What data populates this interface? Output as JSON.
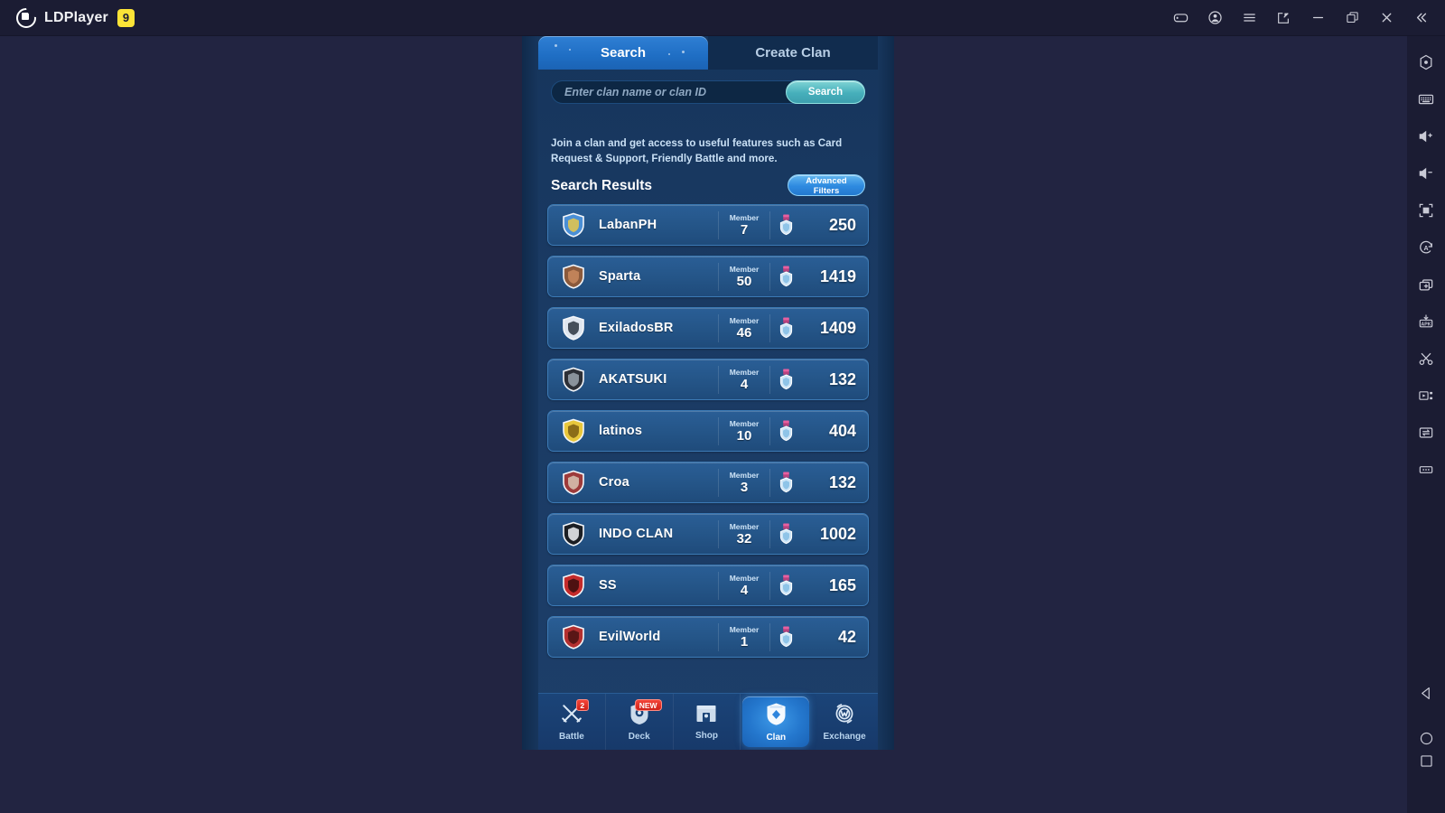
{
  "emulator": {
    "brand_name": "LDPlayer",
    "brand_version": "9",
    "titlebar_buttons": [
      {
        "name": "gamepad-icon",
        "label": "Keyboard Mapping"
      },
      {
        "name": "account-icon",
        "label": "Account"
      },
      {
        "name": "menu-icon",
        "label": "Menu"
      },
      {
        "name": "share-icon",
        "label": "Share"
      },
      {
        "name": "minimize-icon",
        "label": "Minimize"
      },
      {
        "name": "maximize-icon",
        "label": "Maximize"
      },
      {
        "name": "close-icon",
        "label": "Close"
      },
      {
        "name": "collapse-icon",
        "label": "Collapse"
      }
    ],
    "sidebar_buttons": [
      {
        "name": "settings-icon",
        "label": "Settings"
      },
      {
        "name": "keyboard-icon",
        "label": "Keyboard Mapping"
      },
      {
        "name": "volume-up-icon",
        "label": "Volume Up"
      },
      {
        "name": "volume-down-icon",
        "label": "Volume Down"
      },
      {
        "name": "fullscreen-icon",
        "label": "Fullscreen"
      },
      {
        "name": "auto-rotate-icon",
        "label": "Rotate"
      },
      {
        "name": "multi-instance-icon",
        "label": "Multi Instance"
      },
      {
        "name": "apk-install-icon",
        "label": "Install APK"
      },
      {
        "name": "scissors-icon",
        "label": "Screenshot"
      },
      {
        "name": "record-icon",
        "label": "Record"
      },
      {
        "name": "file-transfer-icon",
        "label": "File Transfer"
      },
      {
        "name": "more-icon",
        "label": "More"
      }
    ],
    "android_nav": [
      {
        "name": "back-icon",
        "label": "Back"
      },
      {
        "name": "home-icon",
        "label": "Home"
      },
      {
        "name": "recents-icon",
        "label": "Recents"
      }
    ]
  },
  "game": {
    "tabs": [
      {
        "label": "Search",
        "active": true
      },
      {
        "label": "Create Clan",
        "active": false
      }
    ],
    "search": {
      "placeholder": "Enter clan name or clan ID",
      "value": "",
      "button_label": "Search"
    },
    "description": "Join a clan and get access to useful features such as Card Request & Support, Friendly Battle and more.",
    "results_title": "Search Results",
    "advanced_filters_line1": "Advanced",
    "advanced_filters_line2": "Filters",
    "member_label": "Member",
    "clans": [
      {
        "name": "LabanPH",
        "members": "7",
        "score": "250",
        "badge_color": "#4a8fd6",
        "badge_accent": "#e8c84a"
      },
      {
        "name": "Sparta",
        "members": "50",
        "score": "1419",
        "badge_color": "#8b5a3c",
        "badge_accent": "#c98a5e"
      },
      {
        "name": "ExiladosBR",
        "members": "46",
        "score": "1409",
        "badge_color": "#dfe6ef",
        "badge_accent": "#2b3440"
      },
      {
        "name": "AKATSUKI",
        "members": "4",
        "score": "132",
        "badge_color": "#2c2f36",
        "badge_accent": "#9aa3ad"
      },
      {
        "name": "latinos",
        "members": "10",
        "score": "404",
        "badge_color": "#e8c73c",
        "badge_accent": "#7a5c12"
      },
      {
        "name": "Croa",
        "members": "3",
        "score": "132",
        "badge_color": "#9d3b3b",
        "badge_accent": "#d9c7b5"
      },
      {
        "name": "INDO CLAN",
        "members": "32",
        "score": "1002",
        "badge_color": "#1c1f24",
        "badge_accent": "#f0f2f5"
      },
      {
        "name": "SS",
        "members": "4",
        "score": "165",
        "badge_color": "#c42b2b",
        "badge_accent": "#3a0d0d"
      },
      {
        "name": "EvilWorld",
        "members": "1",
        "score": "42",
        "badge_color": "#b33030",
        "badge_accent": "#4a1212"
      }
    ],
    "bottom_nav": [
      {
        "label": "Battle",
        "icon": "crossed-swords-icon",
        "badge": "2",
        "active": false
      },
      {
        "label": "Deck",
        "icon": "deck-icon",
        "badge": "NEW",
        "active": false
      },
      {
        "label": "Shop",
        "icon": "shop-icon",
        "badge": "",
        "active": false
      },
      {
        "label": "Clan",
        "icon": "clan-shield-icon",
        "badge": "",
        "active": true
      },
      {
        "label": "Exchange",
        "icon": "exchange-icon",
        "badge": "",
        "active": false
      }
    ]
  },
  "colors": {
    "window_bg": "#222441",
    "titlebar_bg": "#1b1c33",
    "brand_yellow": "#fbe337",
    "game_bg": "#1a3a63",
    "tab_active": "#2478cd",
    "search_btn": "#46afbb",
    "row_bg": "#255689",
    "badge_red": "#cf2118"
  }
}
